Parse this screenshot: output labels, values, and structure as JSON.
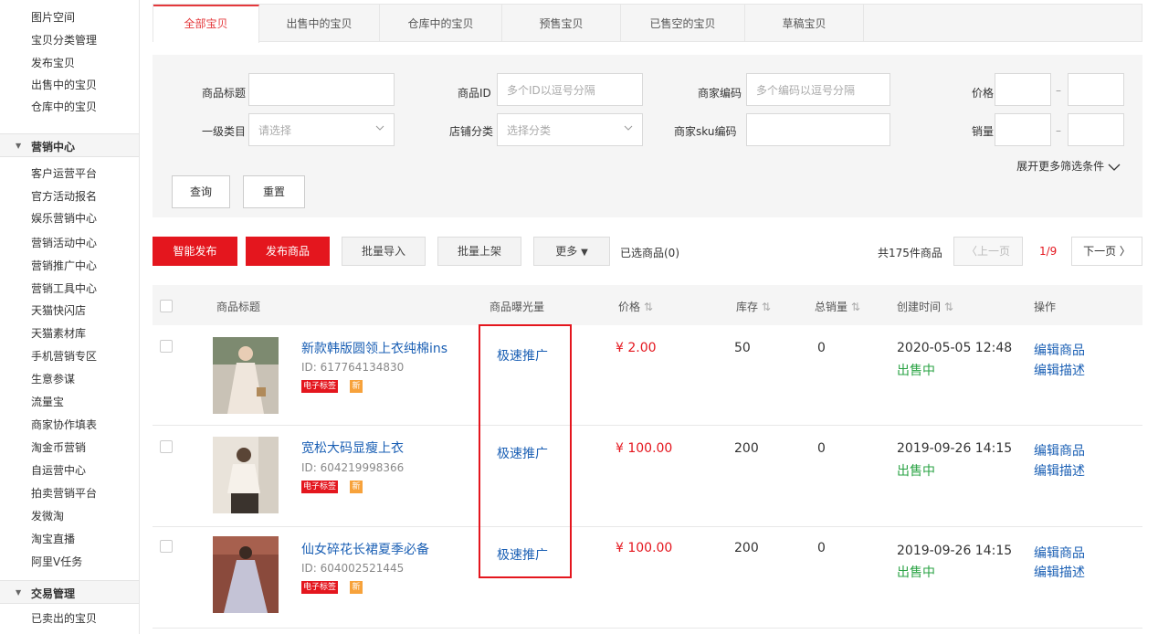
{
  "sidebar": {
    "top_items": [
      "图片空间",
      "宝贝分类管理",
      "发布宝贝",
      "出售中的宝贝",
      "仓库中的宝贝"
    ],
    "marketing": {
      "title": "营销中心",
      "items": [
        "客户运营平台",
        "官方活动报名",
        "娱乐营销中心",
        "营销活动中心",
        "营销推广中心",
        "营销工具中心",
        "天猫快闪店",
        "天猫素材库",
        "手机营销专区",
        "生意参谋",
        "流量宝",
        "商家协作填表",
        "淘金币营销",
        "自运营中心",
        "拍卖营销平台",
        "发微淘",
        "淘宝直播",
        "阿里V任务"
      ]
    },
    "trade": {
      "title": "交易管理",
      "items": [
        "已卖出的宝贝"
      ]
    }
  },
  "tabs": [
    "全部宝贝",
    "出售中的宝贝",
    "仓库中的宝贝",
    "预售宝贝",
    "已售空的宝贝",
    "草稿宝贝"
  ],
  "filters": {
    "title_label": "商品标题",
    "id_label": "商品ID",
    "id_placeholder": "多个ID以逗号分隔",
    "code_label": "商家编码",
    "code_placeholder": "多个编码以逗号分隔",
    "price_label": "价格",
    "category_label": "一级类目",
    "category_placeholder": "请选择",
    "shop_cat_label": "店铺分类",
    "shop_cat_placeholder": "选择分类",
    "sku_label": "商家sku编码",
    "sales_label": "销量",
    "range_dash": "–",
    "expand": "展开更多筛选条件",
    "query_btn": "查询",
    "reset_btn": "重置"
  },
  "actions": {
    "smart_publish": "智能发布",
    "publish": "发布商品",
    "batch_import": "批量导入",
    "batch_list": "批量上架",
    "more": "更多",
    "selected": "已选商品(0)",
    "total": "共175件商品",
    "prev": "上一页",
    "page": "1/9",
    "next": "下一页"
  },
  "table": {
    "headers": {
      "title": "商品标题",
      "exposure": "商品曝光量",
      "price": "价格",
      "stock": "库存",
      "sales": "总销量",
      "created": "创建时间",
      "ops": "操作"
    },
    "rows": [
      {
        "title": "新款韩版圆领上衣纯棉ins",
        "id": "ID: 617764134830",
        "tag": "电子标签",
        "tag2": "新",
        "promo": "极速推广",
        "price": "¥ 2.00",
        "stock": "50",
        "sales": "0",
        "created": "2020-05-05 12:48",
        "status": "出售中",
        "op1": "编辑商品",
        "op2": "编辑描述"
      },
      {
        "title": "宽松大码显瘦上衣",
        "id": "ID: 604219998366",
        "tag": "电子标签",
        "tag2": "新",
        "promo": "极速推广",
        "price": "¥ 100.00",
        "stock": "200",
        "sales": "0",
        "created": "2019-09-26 14:15",
        "status": "出售中",
        "op1": "编辑商品",
        "op2": "编辑描述"
      },
      {
        "title": "仙女碎花长裙夏季必备",
        "id": "ID: 604002521445",
        "tag": "电子标签",
        "tag2": "新",
        "promo": "极速推广",
        "price": "¥ 100.00",
        "stock": "200",
        "sales": "0",
        "created": "2019-09-26 14:15",
        "status": "出售中",
        "op1": "编辑商品",
        "op2": "编辑描述"
      }
    ]
  },
  "colors": {
    "accent": "#e4161e",
    "link": "#1a5fb4",
    "status": "#2aa344"
  }
}
